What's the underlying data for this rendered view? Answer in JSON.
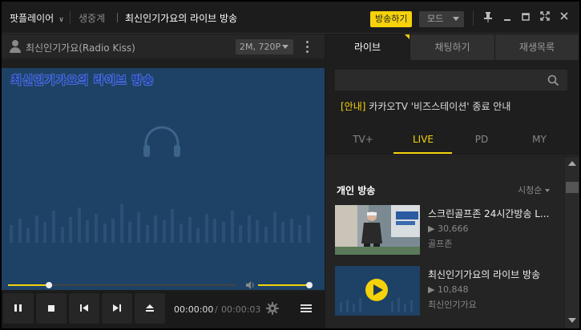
{
  "titlebar": {
    "brand": "팟플레이어",
    "category": "생중계",
    "title": "최신인기가요의 라이브 방송",
    "broadcast_button": "방송하기",
    "mode_label": "모드"
  },
  "player": {
    "channel_name": "최신인기가요(Radio Kiss)",
    "quality": "2M, 720P",
    "overlay_title": "최신인기가요의 라이브 방송",
    "time_current": "00:00:00",
    "time_separator": "/",
    "time_total": "00:00:03",
    "progress": 0.18,
    "volume": 1.0
  },
  "panel": {
    "tabs": [
      {
        "label": "라이브"
      },
      {
        "label": "채팅하기"
      },
      {
        "label": "재생목록"
      }
    ],
    "notice_tag": "[안내]",
    "notice_text": "카카오TV '비즈스테이션' 종료 안내",
    "subtabs": [
      {
        "label": "TV+"
      },
      {
        "label": "LIVE"
      },
      {
        "label": "PD"
      },
      {
        "label": "MY"
      }
    ],
    "section_title": "개인 방송",
    "sort_label": "시청순",
    "items": [
      {
        "title": "스크린골프존 24시간방송 L...",
        "views": "30,666",
        "channel": "골프존"
      },
      {
        "title": "최신인기가요의 라이브 방송",
        "views": "10,848",
        "channel": "최신인기가요"
      }
    ]
  },
  "colors": {
    "accent": "#f5d20a",
    "video_bg": "#1d4265"
  }
}
